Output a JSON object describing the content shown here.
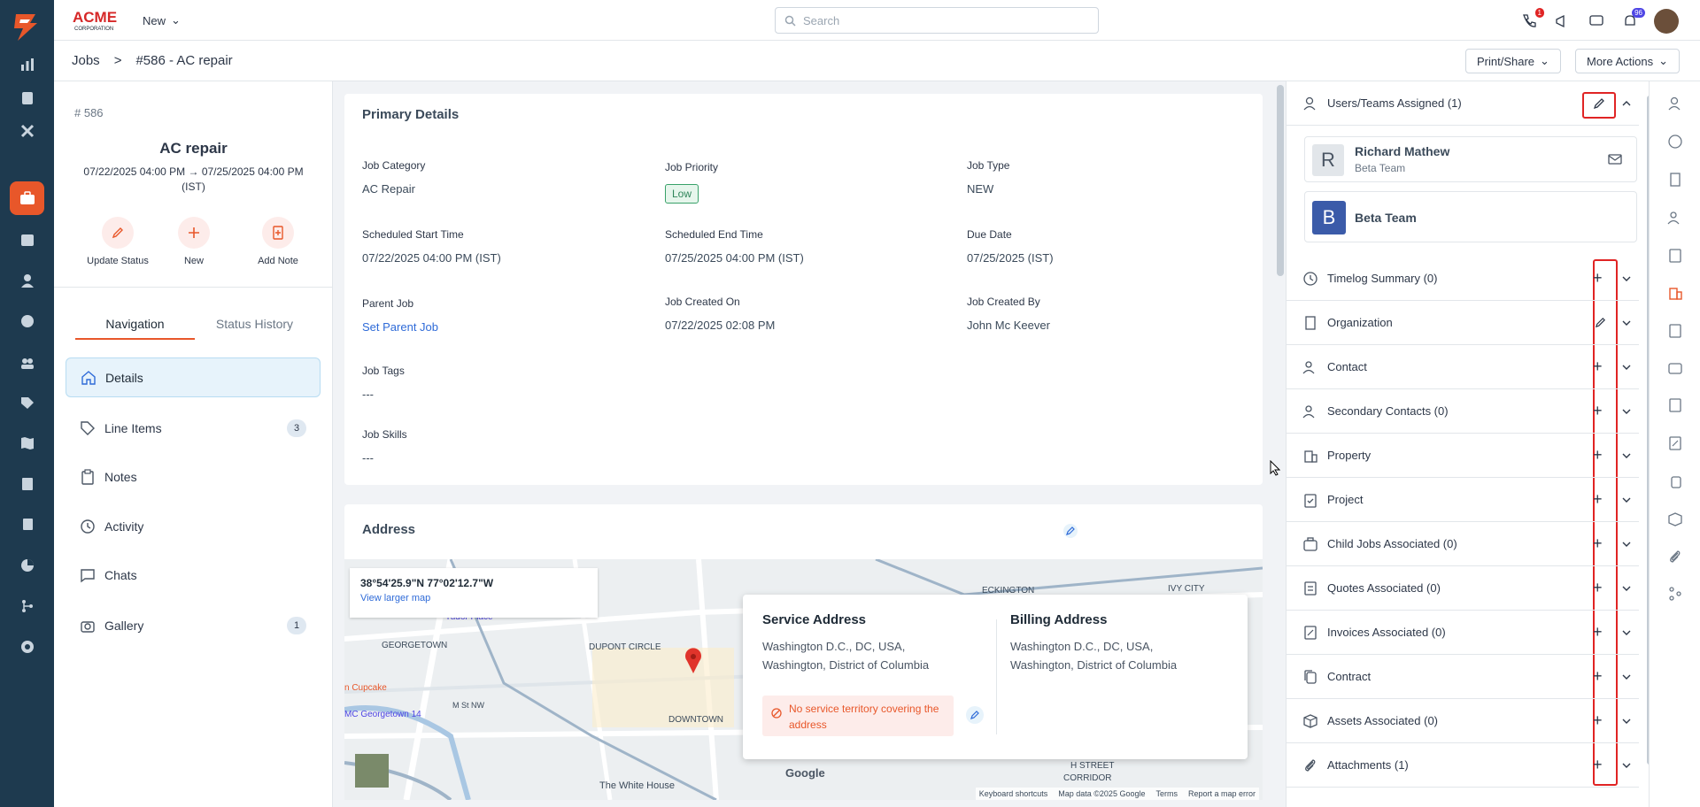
{
  "brand": {
    "name": "ACME CORPORATION"
  },
  "topbar": {
    "new_label": "New",
    "search_placeholder": "Search",
    "notif_count": "96",
    "call_count": "1"
  },
  "breadcrumb": {
    "root": "Jobs",
    "sep": ">",
    "current": "#586 - AC repair"
  },
  "actions": {
    "print_share": "Print/Share",
    "more_actions": "More Actions"
  },
  "job": {
    "number": "# 586",
    "title": "AC repair",
    "dates": "07/22/2025 04:00 PM → 07/25/2025 04:00 PM (IST)",
    "quick_actions": [
      {
        "label": "Update Status",
        "icon": "pencil-icon"
      },
      {
        "label": "New",
        "icon": "plus-icon"
      },
      {
        "label": "Add Note",
        "icon": "note-plus-icon"
      }
    ]
  },
  "nav_tabs": {
    "navigation": "Navigation",
    "status_history": "Status History"
  },
  "nav_items": [
    {
      "label": "Details",
      "icon": "home-icon",
      "count": ""
    },
    {
      "label": "Line Items",
      "icon": "tag-icon",
      "count": "3"
    },
    {
      "label": "Notes",
      "icon": "clipboard-icon",
      "count": ""
    },
    {
      "label": "Activity",
      "icon": "history-icon",
      "count": ""
    },
    {
      "label": "Chats",
      "icon": "chat-icon",
      "count": ""
    },
    {
      "label": "Gallery",
      "icon": "camera-icon",
      "count": "1"
    }
  ],
  "primary": {
    "title": "Primary Details",
    "job_category_label": "Job Category",
    "job_category": "AC Repair",
    "job_priority_label": "Job Priority",
    "job_priority": "Low",
    "job_type_label": "Job Type",
    "job_type": "NEW",
    "sched_start_label": "Scheduled Start Time",
    "sched_start": "07/22/2025 04:00 PM (IST)",
    "sched_end_label": "Scheduled End Time",
    "sched_end": "07/25/2025 04:00 PM (IST)",
    "due_label": "Due Date",
    "due": "07/25/2025 (IST)",
    "parent_label": "Parent Job",
    "parent": "Set Parent Job",
    "created_on_label": "Job Created On",
    "created_on": "07/22/2025 02:08 PM",
    "created_by_label": "Job Created By",
    "created_by": "John Mc Keever",
    "tags_label": "Job Tags",
    "tags": "---",
    "skills_label": "Job Skills",
    "skills": "---"
  },
  "address": {
    "title": "Address",
    "coords": "38°54'25.9\"N 77°02'12.7\"W",
    "view_larger": "View larger map",
    "service_title": "Service Address",
    "service_line1": "Washington D.C., DC, USA,",
    "service_line2": "Washington, District of Columbia",
    "billing_title": "Billing Address",
    "billing_line1": "Washington D.C., DC, USA,",
    "billing_line2": "Washington, District of Columbia",
    "warning": "No service territory covering the address",
    "map_labels": {
      "georgetown": "GEORGETOWN",
      "dupont": "DUPONT CIRCLE",
      "downtown": "DOWNTOWN",
      "eckington": "ECKINGTON",
      "ivy": "IVY CITY",
      "whitehouse": "The White House",
      "tudor": "Tudor Place",
      "cupcake": "n Cupcake",
      "amc": "MC Georgetown 14",
      "hstreet": "H STREET",
      "corridor": "CORRIDOR",
      "mst": "M St NW",
      "google": "Google"
    },
    "map_footer": {
      "shortcuts": "Keyboard shortcuts",
      "data": "Map data ©2025 Google",
      "terms": "Terms",
      "report": "Report a map error"
    }
  },
  "right_panel": {
    "users_title": "Users/Teams Assigned (1)",
    "user_name": "Richard Mathew",
    "user_initial": "R",
    "user_team": "Beta Team",
    "team_name": "Beta Team",
    "team_initial": "B",
    "sections": [
      {
        "label": "Timelog Summary (0)",
        "icon": "clock-icon",
        "action": "+"
      },
      {
        "label": "Organization",
        "icon": "building-icon",
        "action": "edit"
      },
      {
        "label": "Contact",
        "icon": "users-icon",
        "action": "+"
      },
      {
        "label": "Secondary Contacts (0)",
        "icon": "users-icon",
        "action": "+"
      },
      {
        "label": "Property",
        "icon": "property-icon",
        "action": "+"
      },
      {
        "label": "Project",
        "icon": "clipboard-check-icon",
        "action": "+"
      },
      {
        "label": "Child Jobs Associated (0)",
        "icon": "briefcase-icon",
        "action": "+"
      },
      {
        "label": "Quotes Associated (0)",
        "icon": "quote-icon",
        "action": "+"
      },
      {
        "label": "Invoices Associated (0)",
        "icon": "invoice-icon",
        "action": "+"
      },
      {
        "label": "Contract",
        "icon": "copy-icon",
        "action": "+"
      },
      {
        "label": "Assets Associated (0)",
        "icon": "box-icon",
        "action": "+"
      },
      {
        "label": "Attachments (1)",
        "icon": "paperclip-icon",
        "action": "+"
      }
    ]
  },
  "colors": {
    "accent": "#e8572a",
    "rail": "#1e3a4f",
    "link": "#2f6bd8",
    "highlight": "#e02424"
  }
}
